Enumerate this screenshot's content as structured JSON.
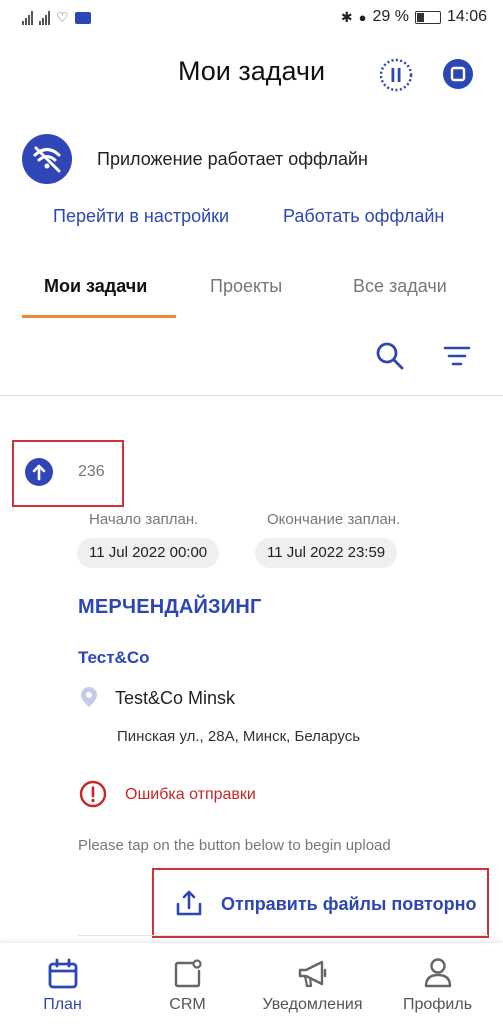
{
  "status_bar": {
    "battery": "29 %",
    "time": "14:06"
  },
  "header": {
    "title": "Мои задачи"
  },
  "offline_banner": {
    "message": "Приложение работает оффлайн",
    "settings_link": "Перейти в настройки",
    "offline_link": "Работать оффлайн"
  },
  "tabs": [
    {
      "label": "Мои задачи",
      "active": true
    },
    {
      "label": "Проекты",
      "active": false
    },
    {
      "label": "Все задачи",
      "active": false
    }
  ],
  "task": {
    "id": "236",
    "start_label": "Начало заплан.",
    "end_label": "Окончание заплан.",
    "start_value": "11 Jul 2022 00:00",
    "end_value": "11 Jul 2022 23:59",
    "title": "МЕРЧЕНДАЙЗИНГ",
    "company": "Тест&Co",
    "store": "Test&Co Minsk",
    "address": "Пинская ул., 28А, Минск, Беларусь",
    "error": "Ошибка отправки",
    "hint": "Please tap on the button below to begin upload",
    "resend_label": "Отправить файлы повторно"
  },
  "nav": [
    {
      "label": "План",
      "icon": "calendar-icon",
      "active": true
    },
    {
      "label": "CRM",
      "icon": "crm-icon",
      "active": false
    },
    {
      "label": "Уведомления",
      "icon": "megaphone-icon",
      "active": false
    },
    {
      "label": "Профиль",
      "icon": "person-icon",
      "active": false
    }
  ],
  "colors": {
    "accent": "#2d46b6",
    "tab_underline": "#e88a3c",
    "error": "#c62828",
    "highlight_box": "#d3303a"
  }
}
